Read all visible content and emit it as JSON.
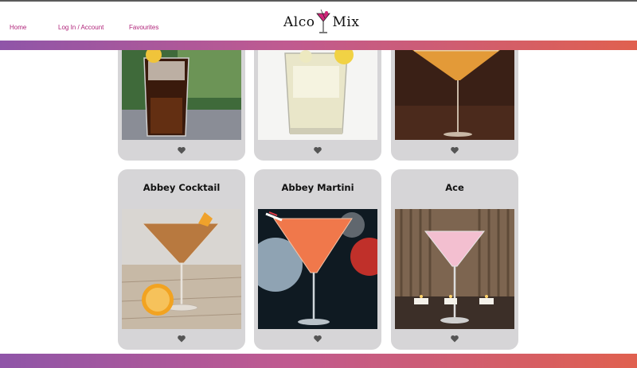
{
  "header": {
    "nav": [
      {
        "label": "Home"
      },
      {
        "label": "Log In / Account"
      },
      {
        "label": "Favourites"
      }
    ],
    "logo": {
      "left": "Alco",
      "right": "Mix"
    }
  },
  "cards_top_row": [
    {
      "title": "",
      "photo": "iced-cola-drink"
    },
    {
      "title": "",
      "photo": "lemon-highball"
    },
    {
      "title": "",
      "photo": "orange-sugar-rim-martini"
    }
  ],
  "cards": [
    {
      "title": "Abbey Cocktail",
      "photo": "amber-martini-orange"
    },
    {
      "title": "Abbey Martini",
      "photo": "red-orange-martini"
    },
    {
      "title": "Ace",
      "photo": "pink-martini-candles"
    }
  ],
  "colors": {
    "accent_pink": "#b0247a",
    "band_start": "#8f55a8",
    "band_end": "#e0604f",
    "card_bg": "#d6d5d7"
  }
}
